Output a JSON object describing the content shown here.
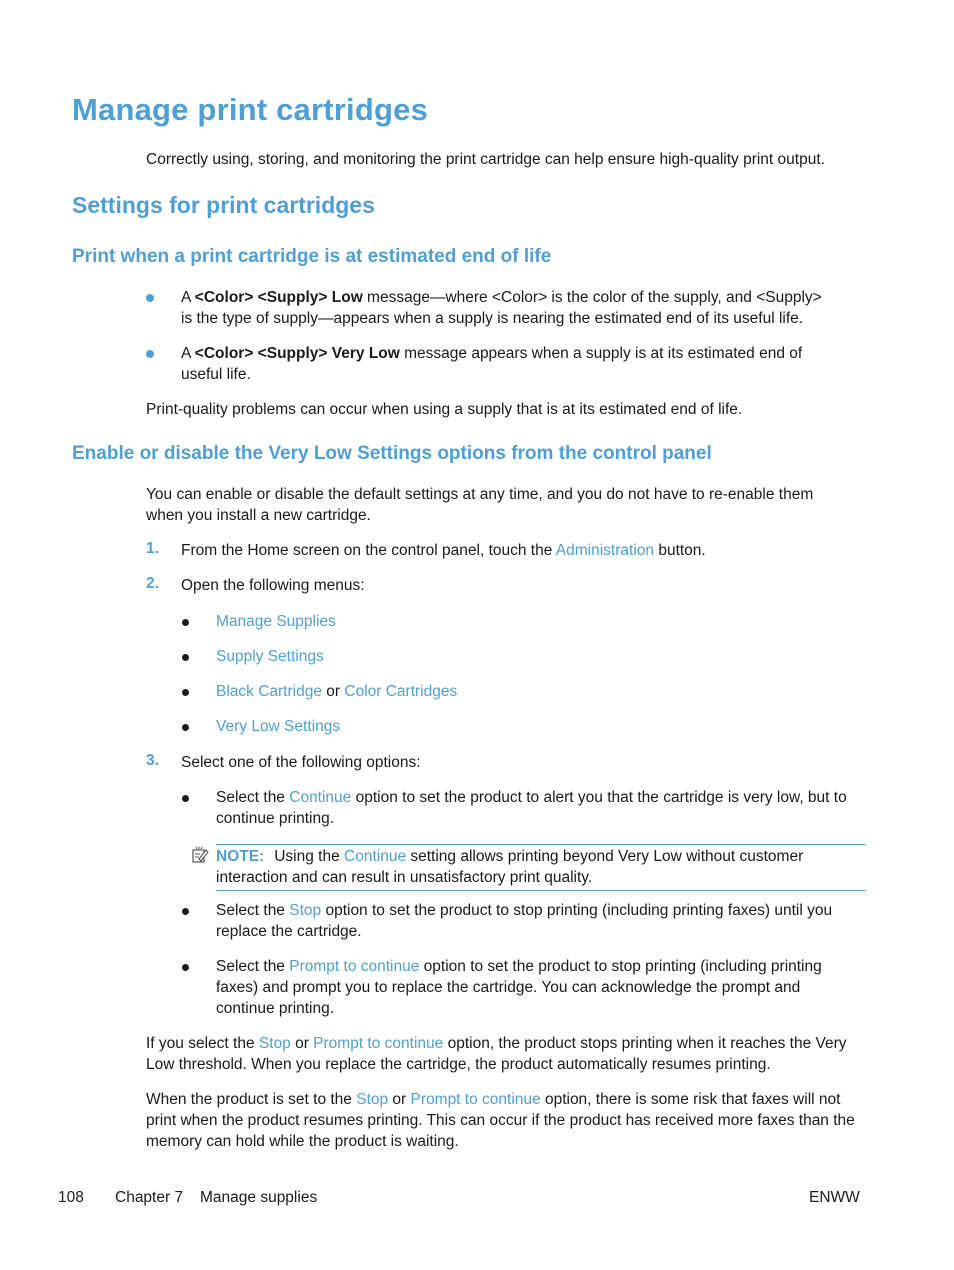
{
  "title": "Manage print cartridges",
  "intro": "Correctly using, storing, and monitoring the print cartridge can help ensure high-quality print output.",
  "section": {
    "heading": "Settings for print cartridges",
    "sub1": {
      "heading": "Print when a print cartridge is at estimated end of life",
      "bullets": [
        {
          "prefix": "A ",
          "bold": "<Color> <Supply> Low",
          "rest_line1": " message—where <Color> is the color of the supply, and <Supply>",
          "rest_line2": "is the type of supply—appears when a supply is nearing the estimated end of its useful life."
        },
        {
          "prefix": "A ",
          "bold": "<Color> <Supply> Very Low",
          "rest_line1": " message appears when a supply is at its estimated end of",
          "rest_line2": "useful life."
        }
      ],
      "para": "Print-quality problems can occur when using a supply that is at its estimated end of life."
    },
    "sub2": {
      "heading": "Enable or disable the Very Low Settings options from the control panel",
      "intro_line1": "You can enable or disable the default settings at any time, and you do not have to re-enable them",
      "intro_line2": "when you install a new cartridge.",
      "steps": [
        {
          "num": "1.",
          "pre": "From the Home screen on the control panel, touch the ",
          "link": "Administration",
          "post": " button."
        },
        {
          "num": "2.",
          "text": "Open the following menus:"
        },
        {
          "num": "3.",
          "text": "Select one of the following options:"
        }
      ],
      "menus": [
        "Manage Supplies",
        "Supply Settings",
        "Black Cartridge",
        "or",
        "Color Cartridges",
        "Very Low Settings"
      ],
      "options": [
        {
          "pre": "Select the ",
          "link": "Continue",
          "post1": " option to set the product to alert you that the cartridge is very low, but to",
          "post2": "continue printing."
        },
        {
          "pre": "Select the ",
          "link": "Stop",
          "post1": " option to set the product to stop printing (including printing faxes) until you",
          "post2": "replace the cartridge."
        },
        {
          "pre": "Select the ",
          "link": "Prompt to continue",
          "post1": " option to set the product to stop printing (including printing",
          "post2": "faxes) and prompt you to replace the cartridge. You can acknowledge the prompt and",
          "post3": "continue printing."
        }
      ],
      "note": {
        "label": "NOTE:",
        "pre": "Using the ",
        "link": "Continue",
        "post1": " setting allows printing beyond Very Low without customer",
        "post2": "interaction and can result in unsatisfactory print quality.",
        "icon": "note-pencil-icon"
      },
      "para1": {
        "pre": "If you select the ",
        "link1": "Stop",
        "mid": " or ",
        "link2": "Prompt to continue",
        "post1": " option, the product stops printing when it reaches the Very",
        "post2": "Low threshold. When you replace the cartridge, the product automatically resumes printing."
      },
      "para2": {
        "pre": "When the product is set to the ",
        "link1": "Stop",
        "mid": " or ",
        "link2": "Prompt to continue",
        "post1": " option, there is some risk that faxes will not",
        "post2": "print when the product resumes printing. This can occur if the product has received more faxes than the",
        "post3": "memory can hold while the product is waiting."
      }
    }
  },
  "footer": {
    "page": "108",
    "chapter": "Chapter 7",
    "chapter_title": "Manage supplies",
    "locale": "ENWW"
  },
  "colors": {
    "accent": "#4d9fd6",
    "text": "#1a1a1a"
  }
}
